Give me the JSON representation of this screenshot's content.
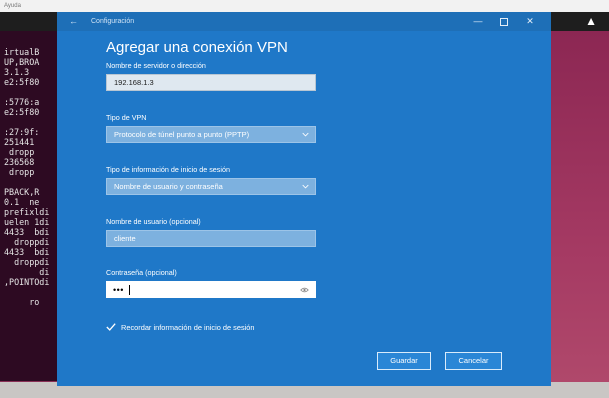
{
  "host": {
    "top_label": "Ayuda"
  },
  "terminal": {
    "lines": [
      "irtualB",
      "UP,BROA",
      "3.1.3",
      "e2:5f80",
      "",
      ":5776:a",
      "e2:5f80",
      "",
      ":27:9f:",
      "251441",
      " dropp",
      "236568",
      " dropp",
      "",
      "PBACK,R",
      "0.1  ne",
      "prefixldi",
      "uelen 1di",
      "4433  bdi",
      "  droppdi",
      "4433  bdi",
      "  droppdi",
      "       di",
      ",POINTOdi",
      "",
      "     ro"
    ]
  },
  "window": {
    "app_title": "Configuración",
    "heading": "Agregar una conexión VPN",
    "server_label": "Nombre de servidor o dirección",
    "server_value": "192.168.1.3",
    "vpn_type_label": "Tipo de VPN",
    "vpn_type_value": "Protocolo de túnel punto a punto (PPTP)",
    "signin_type_label": "Tipo de información de inicio de sesión",
    "signin_type_value": "Nombre de usuario y contraseña",
    "username_label": "Nombre de usuario (opcional)",
    "username_value": "cliente",
    "password_label": "Contraseña (opcional)",
    "password_mask": "•••",
    "remember_label": "Recordar información de inicio de sesión",
    "remember_checked": true,
    "save_label": "Guardar",
    "cancel_label": "Cancelar"
  },
  "icons": {
    "back": "back-arrow-icon",
    "minimize": "minimize-icon",
    "maximize": "maximize-icon",
    "close": "close-icon",
    "chevron": "chevron-down-icon",
    "reveal": "eye-icon",
    "check": "checkmark-icon",
    "host_right": "person-icon"
  },
  "colors": {
    "window_bg": "#1f78c8",
    "title_bar": "#1e6fb7",
    "field_bg": "#7db1df",
    "button_bg": "#2a86d6"
  }
}
